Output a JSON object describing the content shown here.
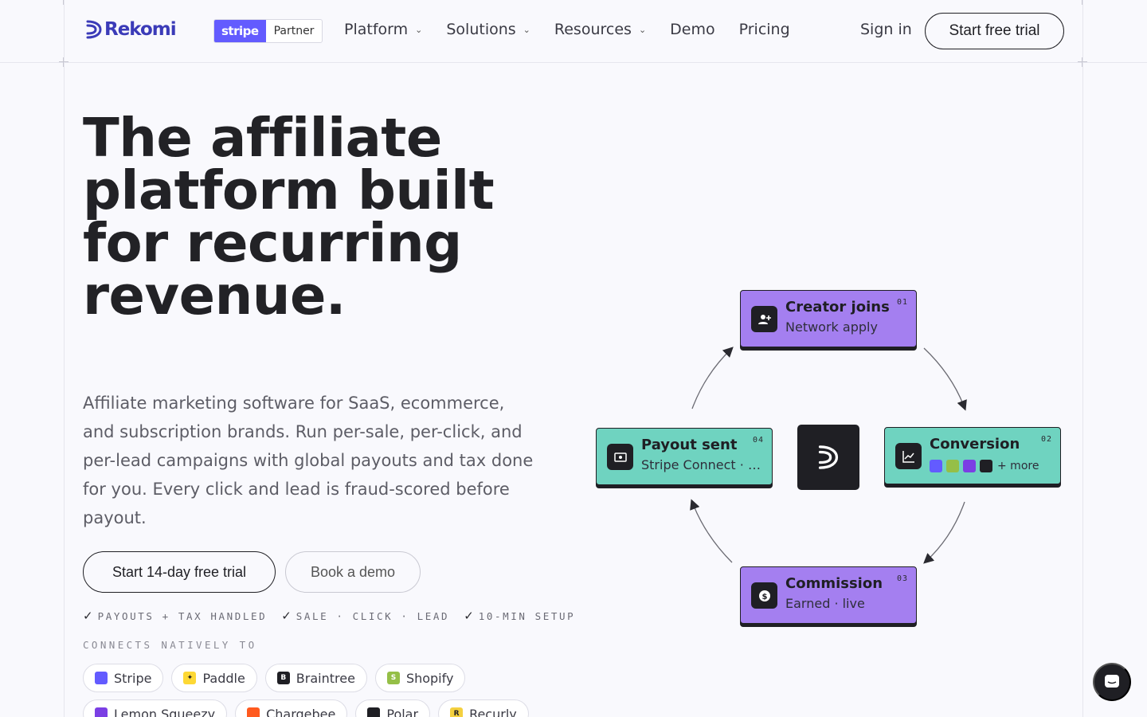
{
  "nav": {
    "logo_text": "Rekomi",
    "partner_badge": {
      "brand": "stripe",
      "label": "Partner"
    },
    "menu": [
      {
        "label": "Platform",
        "has_dropdown": true
      },
      {
        "label": "Solutions",
        "has_dropdown": true
      },
      {
        "label": "Resources",
        "has_dropdown": true
      },
      {
        "label": "Demo",
        "has_dropdown": false
      },
      {
        "label": "Pricing",
        "has_dropdown": false
      }
    ],
    "sign_in": "Sign in",
    "cta": "Start free trial"
  },
  "hero": {
    "title": "The affiliate platform built for recurring revenue.",
    "subtitle": "Affiliate marketing software for SaaS, ecommerce, and subscription brands. Run per-sale, per-click, and per-lead campaigns with global payouts and tax done for you. Every click and lead is fraud-scored before payout.",
    "primary_cta": "Start 14-day free trial",
    "secondary_cta": "Book a demo",
    "checks": [
      "PAYOUTS + TAX HANDLED",
      "SALE · CLICK · LEAD",
      "10-MIN SETUP"
    ],
    "connects_label": "CONNECTS NATIVELY TO",
    "integrations": [
      {
        "name": "Stripe",
        "color": "#635bff",
        "icon": "stripe-icon"
      },
      {
        "name": "Paddle",
        "color": "#fdd835",
        "icon": "paddle-icon"
      },
      {
        "name": "Braintree",
        "color": "#1f1f24",
        "icon": "braintree-icon"
      },
      {
        "name": "Shopify",
        "color": "#95bf47",
        "icon": "shopify-icon"
      },
      {
        "name": "Lemon Squeezy",
        "color": "#7b3fe4",
        "icon": "lemon-squeezy-icon"
      },
      {
        "name": "Chargebee",
        "color": "#ff5a1f",
        "icon": "chargebee-icon"
      },
      {
        "name": "Polar",
        "color": "#1f1f24",
        "icon": "polar-icon"
      },
      {
        "name": "Recurly",
        "color": "#f4d03f",
        "icon": "recurly-icon"
      }
    ]
  },
  "diagram": {
    "nodes": [
      {
        "key": "creator",
        "title": "Creator joins",
        "subtitle": "Network apply",
        "number": "01",
        "icon": "user-plus-icon",
        "color": "#a47ff0"
      },
      {
        "key": "conversion",
        "title": "Conversion",
        "subtitle": "+ more",
        "number": "02",
        "icon": "chart-line-icon",
        "color": "#6fd3c0"
      },
      {
        "key": "commission",
        "title": "Commission",
        "subtitle": "Earned · live",
        "number": "03",
        "icon": "dollar-coin-icon",
        "color": "#a47ff0"
      },
      {
        "key": "payout",
        "title": "Payout sent",
        "subtitle": "Stripe Connect · …",
        "number": "04",
        "icon": "banknote-icon",
        "color": "#6fd3c0"
      }
    ]
  }
}
